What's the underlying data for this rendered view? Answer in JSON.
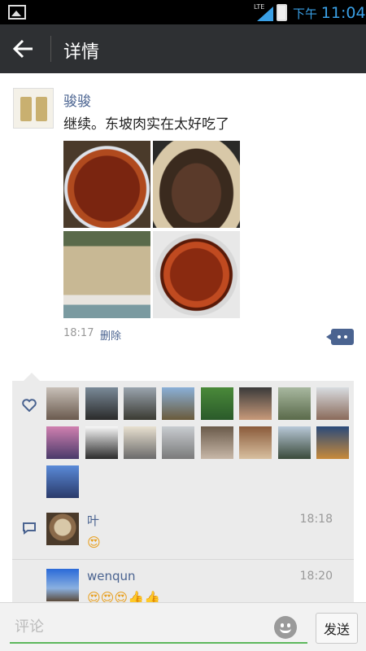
{
  "status_bar": {
    "network": "LTE",
    "period": "下午",
    "time": "11:04"
  },
  "header": {
    "title": "详情"
  },
  "post": {
    "author": "骏骏",
    "text": "继续。东坡肉实在太好吃了",
    "time": "18:17",
    "delete_label": "删除"
  },
  "comments": [
    {
      "name": "叶",
      "time": "18:18",
      "text": "😍"
    },
    {
      "name": "wenqun",
      "time": "18:20",
      "text": "😍😍😍👍👍"
    }
  ],
  "input": {
    "placeholder": "评论"
  },
  "send_label": "发送",
  "colors": {
    "accent": "#4a6390",
    "header_bg": "#2e3033",
    "input_underline": "#5cb85c"
  }
}
